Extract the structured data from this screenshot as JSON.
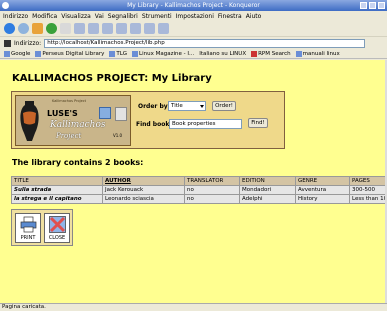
{
  "window": {
    "title": "My Library - Kallimachos Project - Konqueror"
  },
  "menu": [
    "Indirizzo",
    "Modifica",
    "Visualizza",
    "Vai",
    "Segnalibri",
    "Strumenti",
    "Impostazioni",
    "Finestra",
    "Aiuto"
  ],
  "address": {
    "label": "Indirizzo:",
    "url": "http://localhost/Kallimachos.Project/lib.php"
  },
  "bookmarks": [
    "Google",
    "Perseus Digital Library",
    "TLG",
    "Linux Magazine - I...",
    "Italiano su LINUX",
    "RPM Search",
    "manuali linux"
  ],
  "page": {
    "title": "KALLIMACHOS PROJECT: My Library",
    "logo": {
      "header": "Kallimachos Project",
      "line1": "LUSE'S",
      "line2": "Kallimachos",
      "line3": "Project",
      "version": "V1.0"
    },
    "search": {
      "order_label": "Order by",
      "order_value": "Title",
      "order_button": "Order!",
      "find_label": "Find book",
      "find_value": "Book properties",
      "find_button": "Find!"
    },
    "count_text": "The library contains 2 books:",
    "table": {
      "headers": [
        "TITLE",
        "AUTHOR",
        "TRANSLATOR",
        "EDITION",
        "GENRE",
        "PAGES"
      ],
      "rows": [
        [
          "Sulla strada",
          "Jack Kerouack",
          "no",
          "Mondadori",
          "Avventura",
          "300-500"
        ],
        [
          "la strega e il capitano",
          "Leonardo sciascia",
          "no",
          "Adelphi",
          "History",
          "Less than 100"
        ]
      ]
    },
    "actions": {
      "print": "PRINT",
      "close": "CLOSE"
    }
  },
  "status": "Pagina caricata.",
  "colors": {
    "page_bg": "#ffff90",
    "header_bg": "#d4c4a4",
    "titlebar": "#3d6cc4"
  }
}
